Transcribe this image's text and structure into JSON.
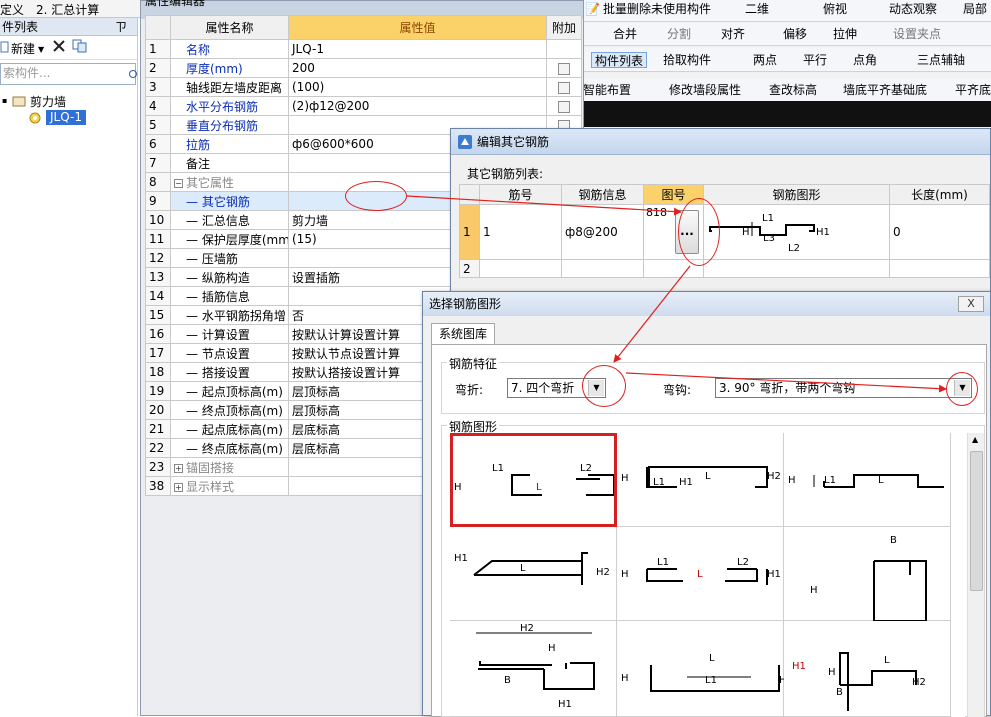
{
  "top_menu": {
    "items": [
      "定义",
      "2. 汇总计算"
    ]
  },
  "left_panel": {
    "header": "件列表",
    "pin": "ㄗ",
    "new_label": "新建",
    "search_placeholder": "索构件...",
    "tree": {
      "root": "剪力墙",
      "child": "JLQ-1"
    }
  },
  "toolbar": {
    "row1": [
      "批量删除未使用构件",
      "二维",
      "俯视",
      "动态观察",
      "局部"
    ],
    "row2": [
      "合并",
      "分割",
      "对齐",
      "偏移",
      "拉伸",
      "设置夹点"
    ],
    "row3": [
      "构件列表",
      "拾取构件",
      "两点",
      "平行",
      "点角",
      "三点辅轴"
    ],
    "row4": [
      "智能布置",
      "修改墙段属性",
      "查改标高",
      "墙底平齐基础底",
      "平齐底"
    ]
  },
  "property_window": {
    "title": "属性编辑器",
    "columns": [
      "属性名称",
      "属性值",
      "附加"
    ],
    "rows": [
      {
        "num": "1",
        "name": "名称",
        "value": "JLQ-1"
      },
      {
        "num": "2",
        "name": "厚度(mm)",
        "value": "200"
      },
      {
        "num": "3",
        "name": "轴线距左墙皮距离",
        "value": "(100)"
      },
      {
        "num": "4",
        "name": "水平分布钢筋",
        "value": "(2)ф12@200"
      },
      {
        "num": "5",
        "name": "垂直分布钢筋",
        "value": ""
      },
      {
        "num": "6",
        "name": "拉筋",
        "value": "ф6@600*600"
      },
      {
        "num": "7",
        "name": "备注",
        "value": ""
      },
      {
        "num": "8",
        "name": "其它属性",
        "value": ""
      },
      {
        "num": "9",
        "name": "其它钢筋",
        "value": ""
      },
      {
        "num": "10",
        "name": "汇总信息",
        "value": "剪力墙"
      },
      {
        "num": "11",
        "name": "保护层厚度(mm)",
        "value": "(15)"
      },
      {
        "num": "12",
        "name": "压墙筋",
        "value": ""
      },
      {
        "num": "13",
        "name": "纵筋构造",
        "value": "设置插筋"
      },
      {
        "num": "14",
        "name": "插筋信息",
        "value": ""
      },
      {
        "num": "15",
        "name": "水平钢筋拐角增",
        "value": "否"
      },
      {
        "num": "16",
        "name": "计算设置",
        "value": "按默认计算设置计算"
      },
      {
        "num": "17",
        "name": "节点设置",
        "value": "按默认节点设置计算"
      },
      {
        "num": "18",
        "name": "搭接设置",
        "value": "按默认搭接设置计算"
      },
      {
        "num": "19",
        "name": "起点顶标高(m)",
        "value": "层顶标高"
      },
      {
        "num": "20",
        "name": "终点顶标高(m)",
        "value": "层顶标高"
      },
      {
        "num": "21",
        "name": "起点底标高(m)",
        "value": "层底标高"
      },
      {
        "num": "22",
        "name": "终点底标高(m)",
        "value": "层底标高"
      },
      {
        "num": "23",
        "name": "锚固搭接",
        "value": ""
      },
      {
        "num": "38",
        "name": "显示样式",
        "value": ""
      }
    ]
  },
  "rebar_dialog": {
    "title": "编辑其它钢筋",
    "list_label": "其它钢筋列表:",
    "columns": [
      "筋号",
      "钢筋信息",
      "图号",
      "钢筋图形",
      "长度(mm)"
    ],
    "rows": [
      {
        "num": "1",
        "bar_no": "1",
        "info": "ф8@200",
        "fig": "818",
        "btn": "...",
        "length": "0"
      },
      {
        "num": "2",
        "bar_no": "",
        "info": "",
        "fig": "",
        "btn": "",
        "length": ""
      }
    ],
    "shape_labels": [
      "L1",
      "H",
      "L3",
      "H1",
      "L2"
    ]
  },
  "shape_dialog": {
    "title": "选择钢筋图形",
    "close": "X",
    "tab": "系统图库",
    "feature_legend": "钢筋特征",
    "bend_label": "弯折:",
    "bend_value": "7. 四个弯折",
    "hook_label": "弯钩:",
    "hook_value": "3. 90° 弯折，带两个弯钩",
    "shapes_legend": "钢筋图形",
    "shapes": [
      {
        "labels": [
          "H",
          "L1",
          "L2",
          "L"
        ]
      },
      {
        "labels": [
          "H",
          "L",
          "H2",
          "L1",
          "H1"
        ]
      },
      {
        "labels": [
          "H",
          "L1",
          "L"
        ]
      },
      {
        "labels": [
          "H1",
          "L",
          "H2"
        ]
      },
      {
        "labels": [
          "H",
          "L1",
          "L2",
          "L",
          "H1"
        ]
      },
      {
        "labels": [
          "B",
          "H"
        ]
      },
      {
        "labels": [
          "H2",
          "H",
          "B",
          "H1"
        ]
      },
      {
        "labels": [
          "H",
          "L",
          "L1",
          "H1"
        ]
      },
      {
        "labels": [
          "H1",
          "H",
          "B",
          "L",
          "H2"
        ]
      }
    ]
  },
  "colors": {
    "accent": "#fbd26a",
    "annotation": "#e02020",
    "selected_row": "#dcebfc",
    "link_blue": "#0a2db8"
  }
}
